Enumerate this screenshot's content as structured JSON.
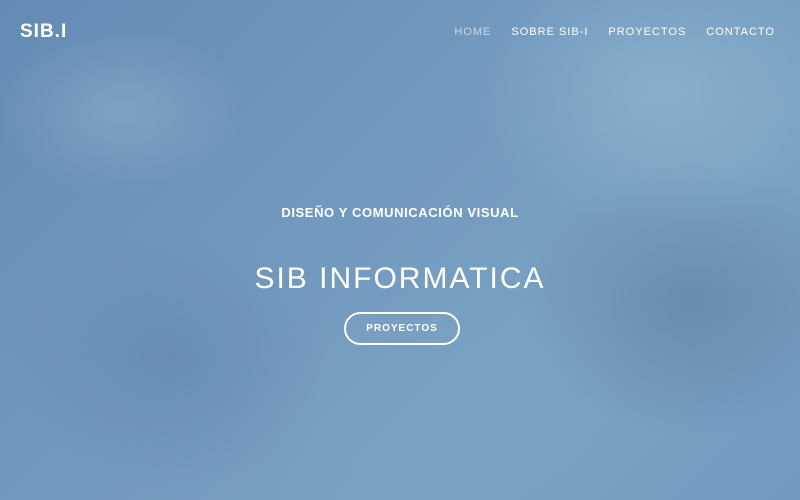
{
  "site": {
    "brand": "SIB.I",
    "nav": {
      "items": [
        {
          "label": "HOME",
          "active": true
        },
        {
          "label": "SOBRE SIB-I",
          "active": false
        },
        {
          "label": "PROYECTOS",
          "active": false
        },
        {
          "label": "CONTACTO",
          "active": false
        }
      ]
    },
    "hero": {
      "kicker": "DISEÑO Y COMUNICACIÓN VISUAL",
      "title": "SIB INFORMATICA",
      "button": "PROYECTOS"
    },
    "colors": {
      "background": "#6f96bb",
      "text": "#ffffff",
      "active_nav": "#b7c8d8"
    }
  }
}
